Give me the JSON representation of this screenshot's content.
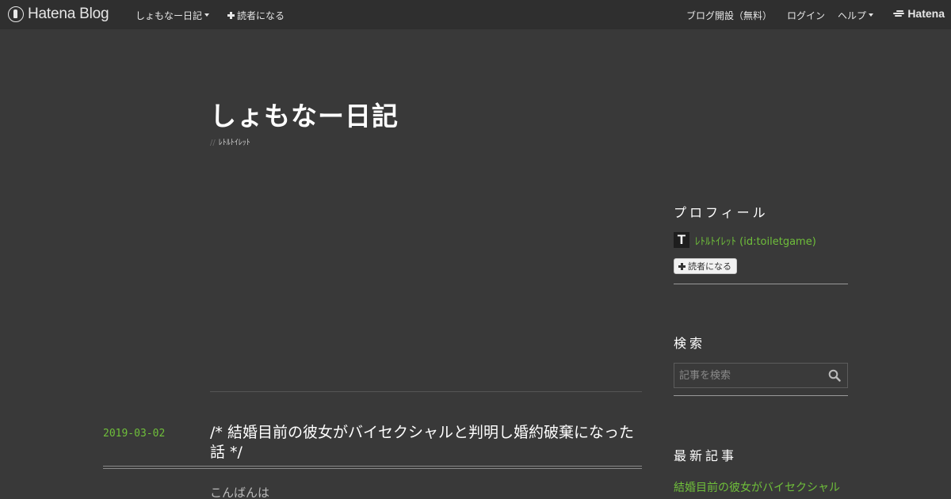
{
  "header": {
    "logo_text": "Hatena Blog",
    "blog_menu": "しょもなー日記",
    "subscribe": "読者になる",
    "open_blog": "ブログ開設（無料）",
    "login": "ログイン",
    "help": "ヘルプ",
    "hatena": "Hatena"
  },
  "blog": {
    "title": "しょもなー日記",
    "desc_prefix": "//",
    "description": "ﾚﾄﾙﾄｲﾚｯﾄ"
  },
  "entry": {
    "date": "2019-03-02",
    "title": "/*  結婚目前の彼女がバイセクシャルと判明し婚約破棄になった話  */",
    "body": "こんばんは"
  },
  "sidebar": {
    "profile_heading": "プロフィール",
    "avatar_letter": "T",
    "profile_name": "ﾚﾄﾙﾄｲﾚｯﾄ (id:toiletgame)",
    "subscribe_button": "読者になる",
    "search_heading": "検索",
    "search_placeholder": "記事を検索",
    "latest_heading": "最新記事",
    "latest_items": [
      "結婚目前の彼女がバイセクシャル"
    ]
  },
  "colors": {
    "background": "#393939",
    "header_bg": "#2f2f2f",
    "accent_green": "#6fbf3a"
  }
}
